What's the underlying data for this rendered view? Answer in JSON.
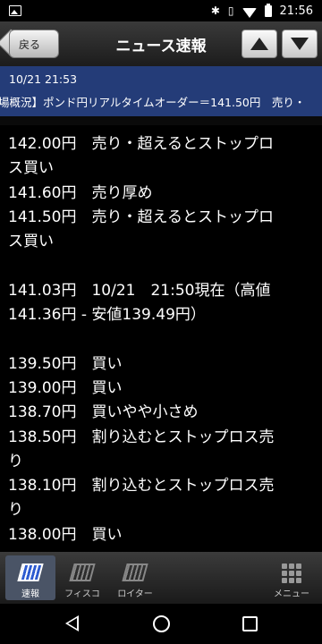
{
  "status_bar": {
    "time": "21:56",
    "icons": [
      "image-icon",
      "bluetooth-icon",
      "vibrate-icon",
      "wifi-icon",
      "battery-icon"
    ]
  },
  "header": {
    "title": "ニュース速報",
    "back_label": "戻る",
    "up_icon": "triangle-up-icon",
    "down_icon": "triangle-down-icon"
  },
  "news": {
    "datetime": "10/21 21:53",
    "headline": "場概況】ポンド円リアルタイムオーダー＝141.50円　売り・"
  },
  "article": {
    "lines": [
      "142.00円　売り・超えるとストップロ",
      "ス買い",
      "141.60円　売り厚め",
      "141.50円　売り・超えるとストップロ",
      "ス買い",
      "",
      "141.03円　10/21　21:50現在（高値",
      "141.36円 - 安値139.49円）",
      "",
      "139.50円　買い",
      "139.00円　買い",
      "138.70円　買いやや小さめ",
      "138.50円　割り込むとストップロス売",
      "り",
      "138.10円　割り込むとストップロス売",
      "り",
      "138.00円　買い"
    ]
  },
  "tabbar": {
    "tabs": [
      {
        "label": "速報",
        "icon": "newspaper-icon",
        "active": true
      },
      {
        "label": "フィスコ",
        "icon": "newspaper-icon",
        "active": false
      },
      {
        "label": "ロイター",
        "icon": "newspaper-icon",
        "active": false
      },
      {
        "label": "メニュー",
        "icon": "grid-menu-icon",
        "active": false
      }
    ]
  },
  "colors": {
    "band": "#243c78",
    "background": "#000000",
    "text": "#ffffff"
  }
}
